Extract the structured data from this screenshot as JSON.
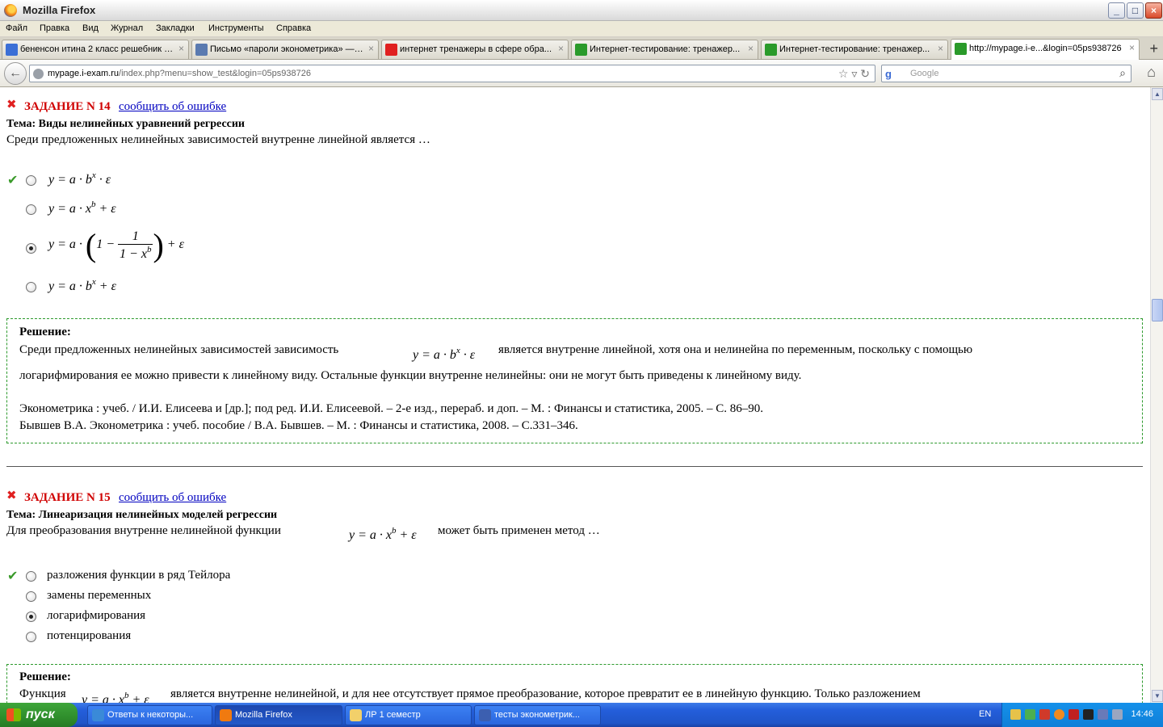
{
  "window": {
    "title": "Mozilla Firefox",
    "buttons": {
      "minimize": "_",
      "maximize": "□",
      "close": "×"
    }
  },
  "menu": [
    "Файл",
    "Правка",
    "Вид",
    "Журнал",
    "Закладки",
    "Инструменты",
    "Справка"
  ],
  "tabs": [
    {
      "label": "бененсон итина 2 класс решебник с...",
      "icon_color": "#3b6fd6"
    },
    {
      "label": "Письмо «пароли эконометрика» — ...",
      "icon_color": "#5a7ab0"
    },
    {
      "label": "интернет тренажеры в сфере обра...",
      "icon_color": "#e02020"
    },
    {
      "label": "Интернет-тестирование: тренажер...",
      "icon_color": "#2a9a2a"
    },
    {
      "label": "Интернет-тестирование: тренажер...",
      "icon_color": "#2a9a2a"
    },
    {
      "label": "http://mypage.i-e...&login=05ps938726",
      "icon_color": "#2a9a2a"
    }
  ],
  "tab_close": "×",
  "new_tab": "+",
  "nav": {
    "back": "←",
    "url_domain": "mypage.i-exam.ru",
    "url_path": "/index.php?menu=show_test&login=05ps938726",
    "search_placeholder": "Google",
    "search_engine_glyph": "g"
  },
  "q14": {
    "task": "ЗАДАНИЕ N 14",
    "report": "сообщить об ошибке",
    "topic": "Тема: Виды нелинейных уравнений регрессии",
    "question": "Среди предложенных нелинейных зависимостей внутренне линейной является …",
    "options": [
      {
        "correct": true,
        "selected": false
      },
      {
        "correct": false,
        "selected": false
      },
      {
        "correct": false,
        "selected": true
      },
      {
        "correct": false,
        "selected": false
      }
    ],
    "solution_title": "Решение:",
    "solution_text_1": "Среди предложенных нелинейных зависимостей зависимость",
    "solution_text_2": "является внутренне линейной, хотя она и нелинейна по переменным, поскольку с помощью",
    "solution_text_3": "логарифмирования ее можно привести к линейному виду. Остальные функции внутренне нелинейны: они не могут быть приведены к линейному виду.",
    "ref_1": "Эконометрика : учеб. / И.И. Елисеева и [др.]; под ред. И.И. Елисеевой. – 2-е изд., перераб. и доп. – М. : Финансы и статистика, 2005. – С. 86–90.",
    "ref_2": "Бывшев В.А. Эконометрика : учеб. пособие / В.А. Бывшев. – М. : Финансы и статистика, 2008. – С.331–346."
  },
  "q15": {
    "task": "ЗАДАНИЕ N 15",
    "report": "сообщить об ошибке",
    "topic": "Тема: Линеаризация нелинейных моделей регрессии",
    "question_1": "Для преобразования внутренне нелинейной функции",
    "question_2": "может быть применен метод …",
    "options": [
      {
        "label": "разложения функции в ряд Тейлора",
        "correct": true,
        "selected": false
      },
      {
        "label": "замены переменных",
        "correct": false,
        "selected": false
      },
      {
        "label": "логарифмирования",
        "correct": false,
        "selected": true
      },
      {
        "label": "потенцирования",
        "correct": false,
        "selected": false
      }
    ],
    "solution_title": "Решение:",
    "solution_text_1": "Функция",
    "solution_text_2": "является внутренне нелинейной, и для нее отсутствует прямое преобразование, которое превратит ее в линейную функцию. Только разложением"
  },
  "taskbar": {
    "start": "пуск",
    "buttons": [
      {
        "label": "Ответы к некоторы...",
        "icon_color": "#3a8ad8",
        "active": false
      },
      {
        "label": "Mozilla Firefox",
        "icon_color": "#f07a10",
        "active": true
      },
      {
        "label": "ЛР 1 семестр",
        "icon_color": "#f2d06a",
        "active": false
      },
      {
        "label": "тесты эконометрик...",
        "icon_color": "#3c5fb0",
        "active": false
      }
    ],
    "lang": "EN",
    "clock": "14:46"
  }
}
